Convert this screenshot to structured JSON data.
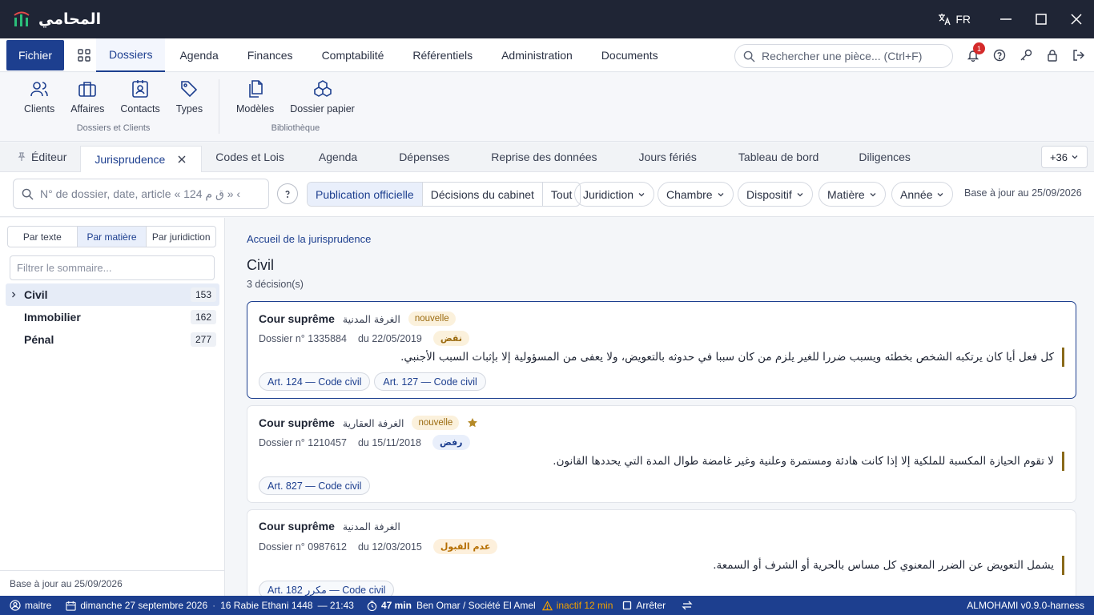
{
  "app": {
    "name": "المحامي",
    "lang": "FR"
  },
  "menu": {
    "fichier": "Fichier",
    "items": [
      "Dossiers",
      "Agenda",
      "Finances",
      "Comptabilité",
      "Référentiels",
      "Administration",
      "Documents"
    ],
    "search_placeholder": "Rechercher une pièce... (Ctrl+F)",
    "notif_count": "1"
  },
  "ribbon": {
    "group1": {
      "label": "Dossiers et Clients",
      "items": [
        "Clients",
        "Affaires",
        "Contacts",
        "Types"
      ]
    },
    "group2": {
      "label": "Bibliothèque",
      "items": [
        "Modèles",
        "Dossier papier"
      ]
    }
  },
  "tabs": {
    "items": [
      "Éditeur",
      "Jurisprudence",
      "Codes et Lois",
      "Agenda",
      "Dépenses",
      "Reprise des données",
      "Jours fériés",
      "Tableau de bord",
      "Diligences"
    ],
    "more": "+36"
  },
  "filters": {
    "search_placeholder": "N° de dossier, date, article « 124 ق م » ‹",
    "segments": [
      "Publication officielle",
      "Décisions du cabinet",
      "Tout"
    ],
    "dropdowns": [
      "Juridiction",
      "Chambre",
      "Dispositif",
      "Matière",
      "Année"
    ],
    "base_date": "Base à jour au 25/09/2026"
  },
  "sidebar": {
    "modes": [
      "Par texte",
      "Par matière",
      "Par juridiction"
    ],
    "filter_placeholder": "Filtrer le sommaire...",
    "items": [
      {
        "label": "Civil",
        "count": "153"
      },
      {
        "label": "Immobilier",
        "count": "162"
      },
      {
        "label": "Pénal",
        "count": "277"
      }
    ],
    "footer": "Base à jour au 25/09/2026"
  },
  "main": {
    "breadcrumb": "Accueil de la jurisprudence",
    "title": "Civil",
    "count": "3 décision(s)",
    "cards": [
      {
        "court": "Cour suprême",
        "chamber": "الغرفة المدنية",
        "badge": "nouvelle",
        "dossier": "Dossier n° 1335884",
        "date": "du 22/05/2019",
        "outcome": "نقض",
        "outcome_color": "#9b6b10",
        "outcome_bg": "#fbf1dc",
        "quote": "كل فعل أيا كان يرتكبه الشخص بخطئه ويسبب ضررا للغير يلزم من كان سببا في حدوثه بالتعويض، ولا يعفى من المسؤولية إلا بإثبات السبب الأجنبي.",
        "arts": [
          "Art. 124 — Code civil",
          "Art. 127 — Code civil"
        ]
      },
      {
        "court": "Cour suprême",
        "chamber": "الغرفة العقارية",
        "badge": "nouvelle",
        "star": true,
        "dossier": "Dossier n° 1210457",
        "date": "du 15/11/2018",
        "outcome": "رفض",
        "outcome_color": "#1d3f8f",
        "outcome_bg": "#e9effb",
        "quote": "لا تقوم الحيازة المكسبة للملكية إلا إذا كانت هادئة ومستمرة وعلنية وغير غامضة طوال المدة التي يحددها القانون.",
        "arts": [
          "Art. 827 — Code civil"
        ]
      },
      {
        "court": "Cour suprême",
        "chamber": "الغرفة المدنية",
        "dossier": "Dossier n° 0987612",
        "date": "du 12/03/2015",
        "outcome": "عدم القبول",
        "outcome_color": "#b56e00",
        "outcome_bg": "#fdf0dc",
        "quote": "يشمل التعويض عن الضرر المعنوي كل مساس بالحرية أو الشرف أو السمعة.",
        "arts": [
          "Art. 182 مكرر — Code civil"
        ]
      }
    ]
  },
  "status": {
    "user": "maitre",
    "date": "dimanche 27 septembre 2026",
    "hijri": "16 Rabie Ethani 1448",
    "time": "— 21:43",
    "timer": "47 min",
    "client": "Ben Omar / Société El Amel",
    "inactive": "inactif 12 min",
    "stop": "Arrêter",
    "version": "ALMOHAMI v0.9.0-harness"
  },
  "colors": {
    "accent": "#1d3f8f",
    "titlebar": "#1f2535",
    "warning": "#f0a000"
  }
}
